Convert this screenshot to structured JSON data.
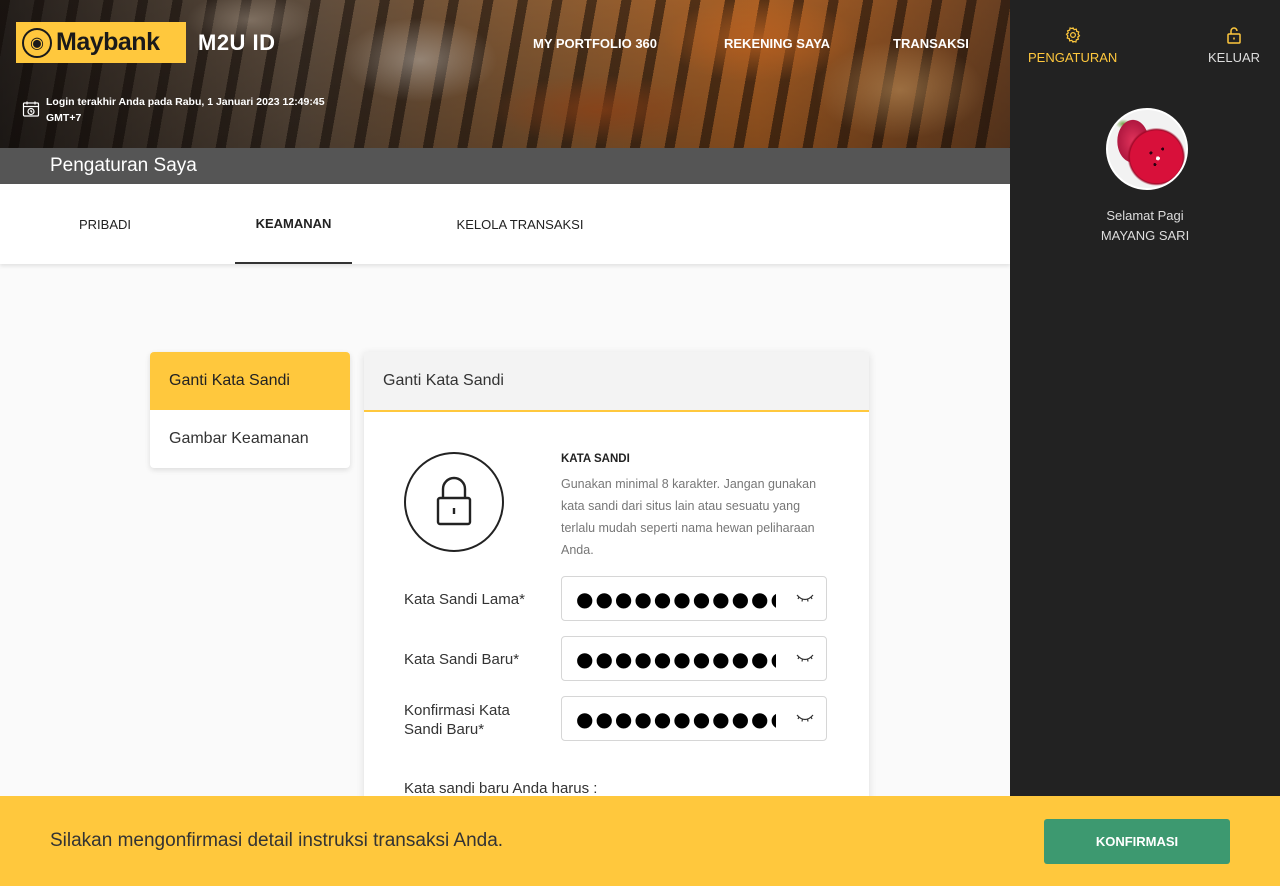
{
  "brand": {
    "logo_text": "Maybank",
    "product": "M2U ID",
    "accent": "#ffc83d"
  },
  "nav": {
    "portfolio": "MY PORTFOLIO 360",
    "accounts": "REKENING SAYA",
    "transactions": "TRANSAKSI"
  },
  "last_login": "Login terakhir Anda pada Rabu, 1 Januari 2023 12:49:45 GMT+7",
  "page_title": "Pengaturan Saya",
  "tabs": [
    {
      "label": "PRIBADI",
      "active": false
    },
    {
      "label": "KEAMANAN",
      "active": true
    },
    {
      "label": "KELOLA TRANSAKSI",
      "active": false
    }
  ],
  "right_panel": {
    "settings_label": "PENGATURAN",
    "logout_label": "KELUAR",
    "greeting": "Selamat Pagi",
    "user_name": "MAYANG SARI"
  },
  "side_menu": [
    {
      "label": "Ganti Kata Sandi",
      "active": true
    },
    {
      "label": "Gambar Keamanan",
      "active": false
    }
  ],
  "card": {
    "title": "Ganti Kata Sandi",
    "pw_title": "KATA SANDI",
    "pw_description": "Gunakan minimal 8 karakter. Jangan gunakan kata sandi dari situs lain atau sesuatu yang terlalu mudah seperti nama hewan peliharaan Anda.",
    "fields": {
      "old": {
        "label": "Kata Sandi Lama*",
        "value": "●●●●●●●●●●●"
      },
      "new": {
        "label": "Kata Sandi Baru*",
        "value": "●●●●●●●●●●●●●"
      },
      "confirm": {
        "label": "Konfirmasi Kata Sandi Baru*",
        "value": "●●●●●●●●●●●●●"
      }
    },
    "rules_title": "Kata sandi baru Anda harus :"
  },
  "footer": {
    "message": "Silakan mengonfirmasi detail instruksi transaksi Anda.",
    "confirm_button": "KONFIRMASI"
  }
}
